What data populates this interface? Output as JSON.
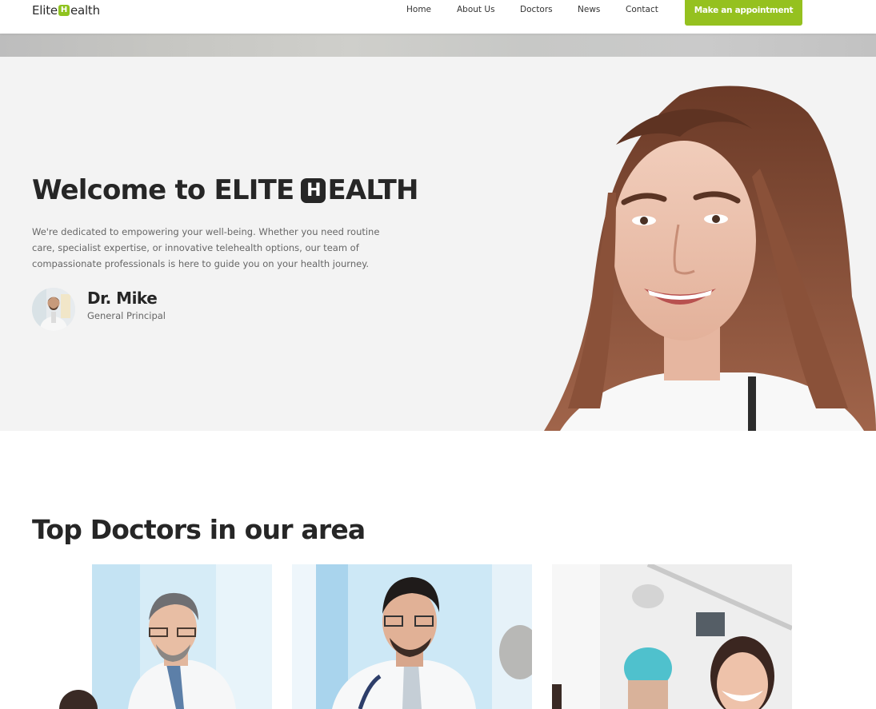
{
  "brand": {
    "logo_prefix": "Elite",
    "logo_mark": "H",
    "logo_suffix": "ealth",
    "accent_color": "#95c11f"
  },
  "nav": {
    "items": [
      {
        "label": "Home"
      },
      {
        "label": "About Us"
      },
      {
        "label": "Doctors"
      },
      {
        "label": "News"
      },
      {
        "label": "Contact"
      }
    ],
    "cta_label": "Make an appointment"
  },
  "hero": {
    "title_prefix": "Welcome to ELITE",
    "title_mark": "H",
    "title_suffix": "EALTH",
    "description": "We're dedicated to empowering your well-being. Whether you need routine care, specialist expertise, or innovative telehealth options, our team of compassionate professionals is here to guide you on your health journey.",
    "author_name": "Dr. Mike",
    "author_role": "General Principal"
  },
  "doctors_section": {
    "title": "Top Doctors in our area"
  }
}
